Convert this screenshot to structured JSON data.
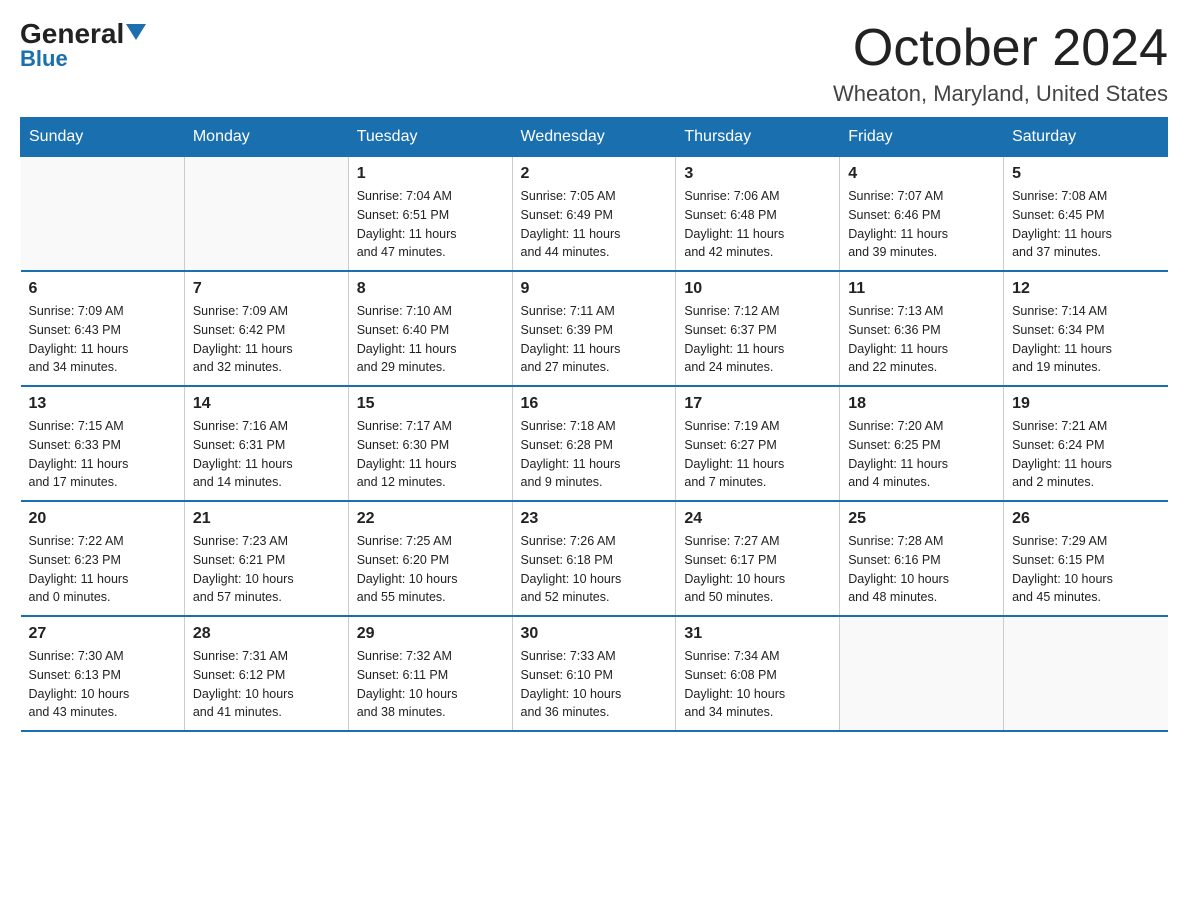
{
  "header": {
    "logo_general": "General",
    "logo_blue": "Blue",
    "month_title": "October 2024",
    "location": "Wheaton, Maryland, United States"
  },
  "days_of_week": [
    "Sunday",
    "Monday",
    "Tuesday",
    "Wednesday",
    "Thursday",
    "Friday",
    "Saturday"
  ],
  "weeks": [
    [
      {
        "day": "",
        "info": ""
      },
      {
        "day": "",
        "info": ""
      },
      {
        "day": "1",
        "info": "Sunrise: 7:04 AM\nSunset: 6:51 PM\nDaylight: 11 hours\nand 47 minutes."
      },
      {
        "day": "2",
        "info": "Sunrise: 7:05 AM\nSunset: 6:49 PM\nDaylight: 11 hours\nand 44 minutes."
      },
      {
        "day": "3",
        "info": "Sunrise: 7:06 AM\nSunset: 6:48 PM\nDaylight: 11 hours\nand 42 minutes."
      },
      {
        "day": "4",
        "info": "Sunrise: 7:07 AM\nSunset: 6:46 PM\nDaylight: 11 hours\nand 39 minutes."
      },
      {
        "day": "5",
        "info": "Sunrise: 7:08 AM\nSunset: 6:45 PM\nDaylight: 11 hours\nand 37 minutes."
      }
    ],
    [
      {
        "day": "6",
        "info": "Sunrise: 7:09 AM\nSunset: 6:43 PM\nDaylight: 11 hours\nand 34 minutes."
      },
      {
        "day": "7",
        "info": "Sunrise: 7:09 AM\nSunset: 6:42 PM\nDaylight: 11 hours\nand 32 minutes."
      },
      {
        "day": "8",
        "info": "Sunrise: 7:10 AM\nSunset: 6:40 PM\nDaylight: 11 hours\nand 29 minutes."
      },
      {
        "day": "9",
        "info": "Sunrise: 7:11 AM\nSunset: 6:39 PM\nDaylight: 11 hours\nand 27 minutes."
      },
      {
        "day": "10",
        "info": "Sunrise: 7:12 AM\nSunset: 6:37 PM\nDaylight: 11 hours\nand 24 minutes."
      },
      {
        "day": "11",
        "info": "Sunrise: 7:13 AM\nSunset: 6:36 PM\nDaylight: 11 hours\nand 22 minutes."
      },
      {
        "day": "12",
        "info": "Sunrise: 7:14 AM\nSunset: 6:34 PM\nDaylight: 11 hours\nand 19 minutes."
      }
    ],
    [
      {
        "day": "13",
        "info": "Sunrise: 7:15 AM\nSunset: 6:33 PM\nDaylight: 11 hours\nand 17 minutes."
      },
      {
        "day": "14",
        "info": "Sunrise: 7:16 AM\nSunset: 6:31 PM\nDaylight: 11 hours\nand 14 minutes."
      },
      {
        "day": "15",
        "info": "Sunrise: 7:17 AM\nSunset: 6:30 PM\nDaylight: 11 hours\nand 12 minutes."
      },
      {
        "day": "16",
        "info": "Sunrise: 7:18 AM\nSunset: 6:28 PM\nDaylight: 11 hours\nand 9 minutes."
      },
      {
        "day": "17",
        "info": "Sunrise: 7:19 AM\nSunset: 6:27 PM\nDaylight: 11 hours\nand 7 minutes."
      },
      {
        "day": "18",
        "info": "Sunrise: 7:20 AM\nSunset: 6:25 PM\nDaylight: 11 hours\nand 4 minutes."
      },
      {
        "day": "19",
        "info": "Sunrise: 7:21 AM\nSunset: 6:24 PM\nDaylight: 11 hours\nand 2 minutes."
      }
    ],
    [
      {
        "day": "20",
        "info": "Sunrise: 7:22 AM\nSunset: 6:23 PM\nDaylight: 11 hours\nand 0 minutes."
      },
      {
        "day": "21",
        "info": "Sunrise: 7:23 AM\nSunset: 6:21 PM\nDaylight: 10 hours\nand 57 minutes."
      },
      {
        "day": "22",
        "info": "Sunrise: 7:25 AM\nSunset: 6:20 PM\nDaylight: 10 hours\nand 55 minutes."
      },
      {
        "day": "23",
        "info": "Sunrise: 7:26 AM\nSunset: 6:18 PM\nDaylight: 10 hours\nand 52 minutes."
      },
      {
        "day": "24",
        "info": "Sunrise: 7:27 AM\nSunset: 6:17 PM\nDaylight: 10 hours\nand 50 minutes."
      },
      {
        "day": "25",
        "info": "Sunrise: 7:28 AM\nSunset: 6:16 PM\nDaylight: 10 hours\nand 48 minutes."
      },
      {
        "day": "26",
        "info": "Sunrise: 7:29 AM\nSunset: 6:15 PM\nDaylight: 10 hours\nand 45 minutes."
      }
    ],
    [
      {
        "day": "27",
        "info": "Sunrise: 7:30 AM\nSunset: 6:13 PM\nDaylight: 10 hours\nand 43 minutes."
      },
      {
        "day": "28",
        "info": "Sunrise: 7:31 AM\nSunset: 6:12 PM\nDaylight: 10 hours\nand 41 minutes."
      },
      {
        "day": "29",
        "info": "Sunrise: 7:32 AM\nSunset: 6:11 PM\nDaylight: 10 hours\nand 38 minutes."
      },
      {
        "day": "30",
        "info": "Sunrise: 7:33 AM\nSunset: 6:10 PM\nDaylight: 10 hours\nand 36 minutes."
      },
      {
        "day": "31",
        "info": "Sunrise: 7:34 AM\nSunset: 6:08 PM\nDaylight: 10 hours\nand 34 minutes."
      },
      {
        "day": "",
        "info": ""
      },
      {
        "day": "",
        "info": ""
      }
    ]
  ]
}
